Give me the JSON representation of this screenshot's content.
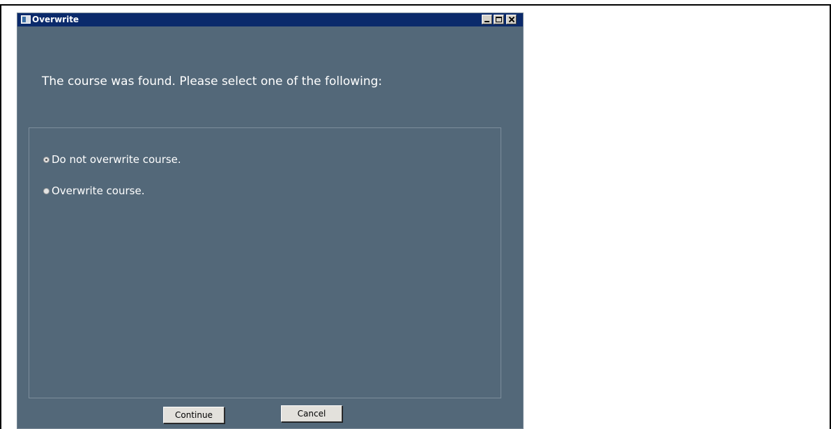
{
  "window": {
    "title": "Overwrite"
  },
  "dialog": {
    "prompt": "The course was found. Please select one of the following:",
    "options": [
      {
        "label": "Do not overwrite course.",
        "selected": true
      },
      {
        "label": "Overwrite course.",
        "selected": false
      }
    ]
  },
  "buttons": {
    "continue_label": "Continue",
    "cancel_label": "Cancel"
  },
  "icons": {
    "app": "app-window-icon",
    "minimize": "minimize-icon",
    "maximize": "maximize-icon",
    "close": "close-icon"
  },
  "colors": {
    "title_bar": "#0b2a6b",
    "window_bg": "#536879",
    "text": "#ffffff"
  }
}
